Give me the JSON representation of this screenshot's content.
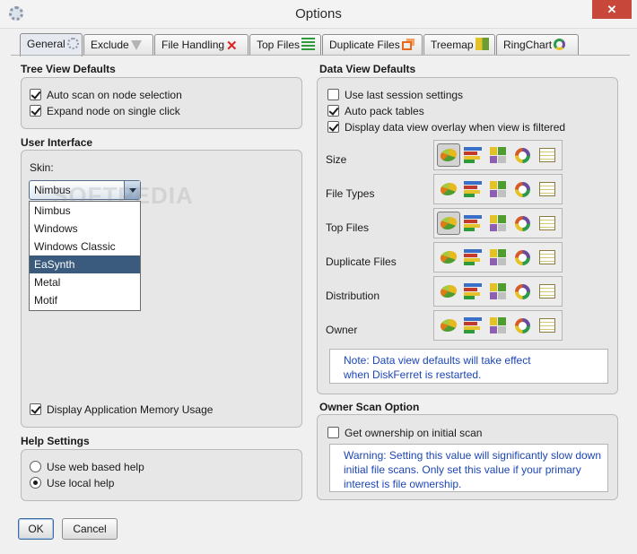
{
  "window": {
    "title": "Options",
    "close_glyph": "✕",
    "icon": "gear-icon"
  },
  "tabs": [
    {
      "label": "General",
      "icon": "gear-icon"
    },
    {
      "label": "Exclude",
      "icon": "funnel-icon"
    },
    {
      "label": "File Handling",
      "icon": "red-x-icon"
    },
    {
      "label": "Top Files",
      "icon": "green-lines-icon"
    },
    {
      "label": "Duplicate Files",
      "icon": "duplicate-squares-icon"
    },
    {
      "label": "Treemap",
      "icon": "treemap-icon"
    },
    {
      "label": "RingChart",
      "icon": "ring-chart-icon"
    }
  ],
  "tree_view": {
    "title": "Tree View Defaults",
    "auto_scan": {
      "label": "Auto scan on node selection",
      "checked": true
    },
    "expand_node": {
      "label": "Expand node on single click",
      "checked": true
    }
  },
  "user_interface": {
    "title": "User Interface",
    "skin_label": "Skin:",
    "skin_value": "Nimbus",
    "skin_options": [
      "Nimbus",
      "Windows",
      "Windows Classic",
      "EaSynth",
      "Metal",
      "Motif"
    ],
    "highlighted_option": "EaSynth",
    "watermark": "SOFTPEDIA",
    "memory_usage": {
      "label": "Display Application Memory Usage",
      "checked": true
    }
  },
  "help_settings": {
    "title": "Help Settings",
    "web_help": {
      "label": "Use web based help",
      "selected": false
    },
    "local_help": {
      "label": "Use local help",
      "selected": true
    }
  },
  "data_view": {
    "title": "Data View Defaults",
    "last_session": {
      "label": "Use last session settings",
      "checked": false
    },
    "auto_pack": {
      "label": "Auto pack tables",
      "checked": true
    },
    "overlay": {
      "label": "Display data view overlay when view is filtered",
      "checked": true
    },
    "rows": [
      {
        "label": "Size",
        "selected": "pie"
      },
      {
        "label": "File Types",
        "selected": "none"
      },
      {
        "label": "Top Files",
        "selected": "pie"
      },
      {
        "label": "Duplicate Files",
        "selected": "none"
      },
      {
        "label": "Distribution",
        "selected": "none"
      },
      {
        "label": "Owner",
        "selected": "none"
      }
    ],
    "view_types": [
      "pie-chart-icon",
      "bar-chart-icon",
      "treemap-icon",
      "ring-chart-icon",
      "table-icon"
    ],
    "note_line1": "Note: Data view defaults will take effect",
    "note_line2": "when DiskFerret is restarted."
  },
  "owner_scan": {
    "title": "Owner Scan Option",
    "get_ownership": {
      "label": "Get ownership on initial scan",
      "checked": false
    },
    "warning_line1": "Warning: Setting this value will significantly slow down",
    "warning_line2": "initial file scans.  Only set this value if your primary",
    "warning_line3": "interest is file ownership."
  },
  "buttons": {
    "ok": "OK",
    "cancel": "Cancel"
  },
  "colors": {
    "accent": "#3b5b7e",
    "note_text": "#1d46b6",
    "close_red": "#c7473b"
  }
}
